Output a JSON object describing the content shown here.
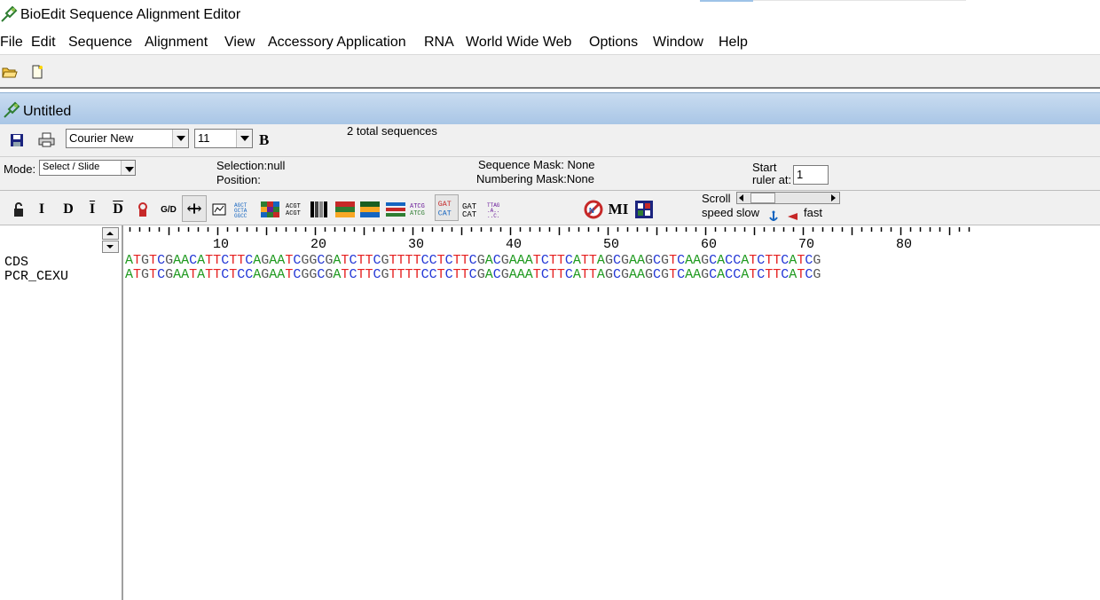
{
  "window": {
    "title": "BioEdit Sequence Alignment Editor"
  },
  "menu": [
    "File",
    "Edit",
    "Sequence",
    "Alignment",
    "View",
    "Accessory Application",
    "RNA",
    "World Wide Web",
    "Options",
    "Window",
    "Help"
  ],
  "document": {
    "title": "Untitled",
    "total_sequences": "2 total sequences"
  },
  "font": {
    "name": "Courier New",
    "size": "11",
    "bold_label": "B"
  },
  "mode": {
    "label": "Mode:",
    "value": "Select / Slide"
  },
  "selection": {
    "selection_label": "Selection:null",
    "position_label": "Position:"
  },
  "masks": {
    "sequence_mask": "Sequence Mask: None",
    "numbering_mask": "Numbering Mask:None"
  },
  "ruler": {
    "start_label": "Start",
    "ruler_at_label": "ruler at:",
    "ruler_at_value": "1",
    "numbers": [
      "10",
      "20",
      "30",
      "40",
      "50",
      "60",
      "70",
      "80"
    ]
  },
  "scroll": {
    "label": "Scroll",
    "speed_slow": "speed slow",
    "fast": "fast"
  },
  "toolbar_text": {
    "mi_label": "MI",
    "gd_label": "G/D"
  },
  "colors": {
    "A": "#1f9a1f",
    "T": "#e52020",
    "C": "#2438d6",
    "G": "#555555"
  },
  "sequences": [
    {
      "name": "CDS",
      "seq": "ATGTCGAACATTCTTCAGAATCGGCGATCTTCGTTTTCCTCTTCGACGAAATCTTCATTAGCGAAGCGTCAAGCACCATCTTCATCG"
    },
    {
      "name": "PCR_CEXU",
      "seq": "ATGTCGAATATTCTCCAGAATCGGCGATCTTCGTTTTCCTCTTCGACGAAATCTTCATTAGCGAAGCGTCAAGCACCATCTTCATCG"
    }
  ]
}
